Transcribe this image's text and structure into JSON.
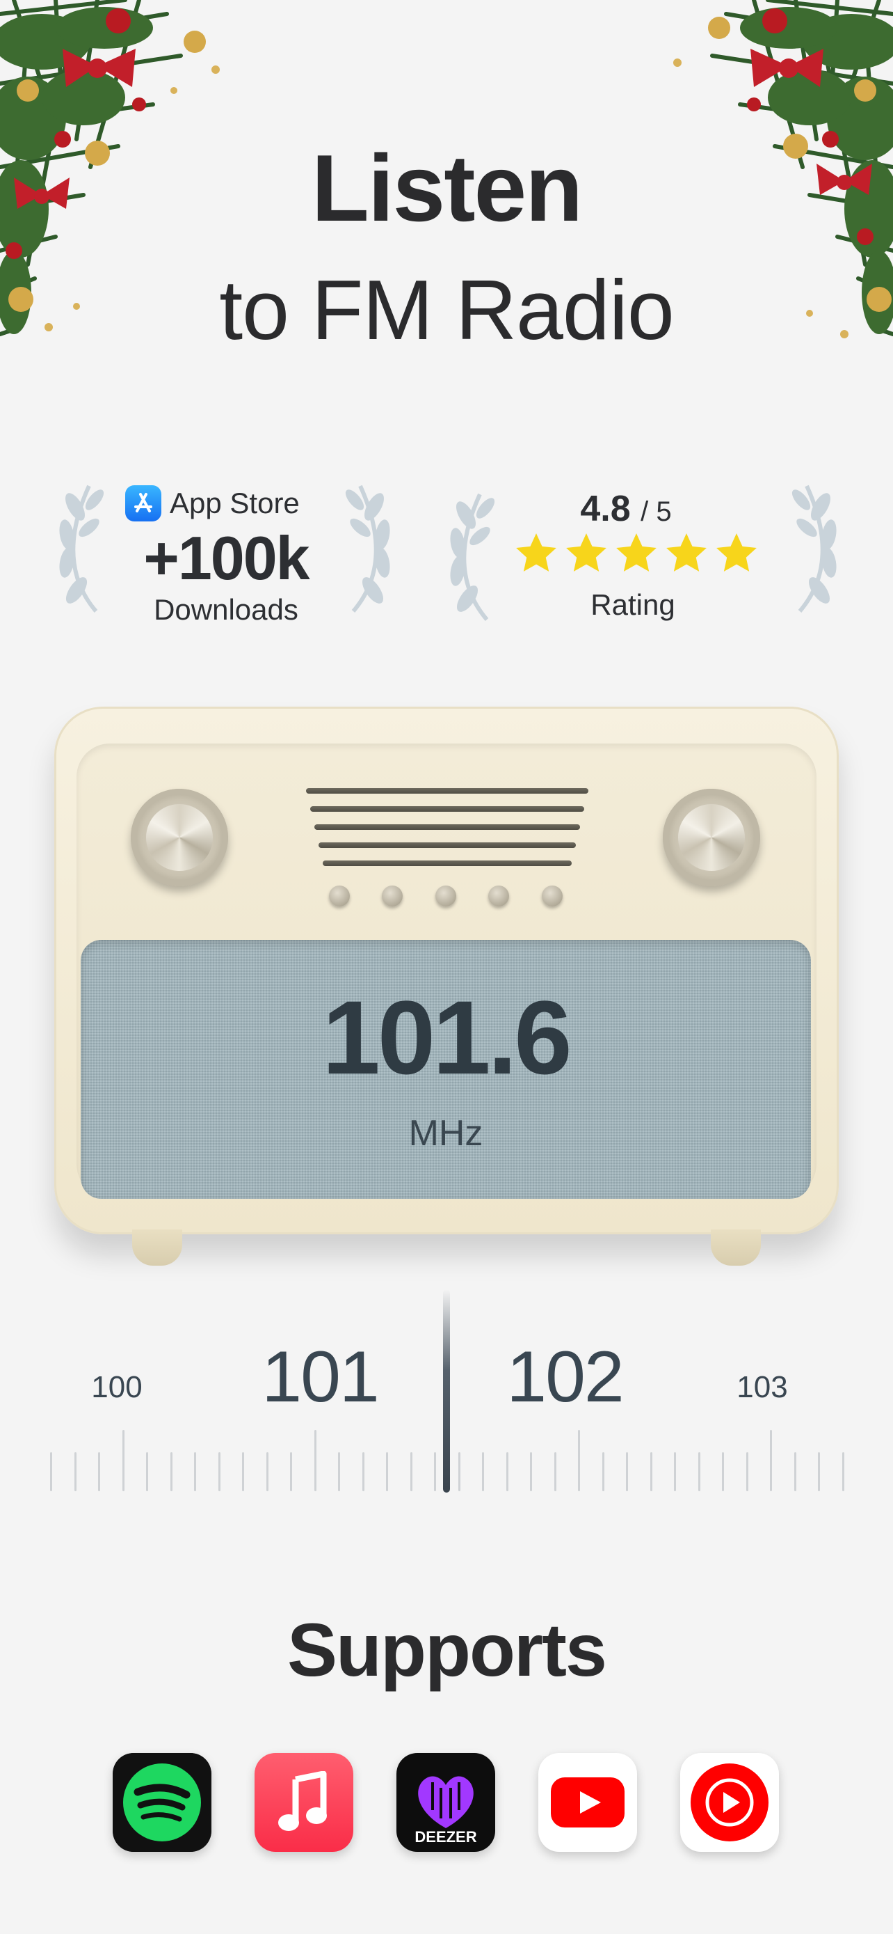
{
  "hero": {
    "title_line1": "Listen",
    "title_line2": "to FM Radio"
  },
  "badges": {
    "downloads": {
      "store_label": "App Store",
      "store_icon": "app-store-icon",
      "count": "+100k",
      "label": "Downloads"
    },
    "rating": {
      "value": "4.8",
      "scale": "/ 5",
      "stars": 5,
      "label": "Rating",
      "star_color": "#f7d51b"
    }
  },
  "radio": {
    "frequency": "101.6",
    "unit": "MHz",
    "body_color": "#f3ecd8",
    "screen_color": "#9eb3ba"
  },
  "dial": {
    "labels": [
      "100",
      "101",
      "102",
      "103"
    ]
  },
  "supports": {
    "title": "Supports",
    "apps": [
      {
        "name": "spotify-icon",
        "color": "#1ed760"
      },
      {
        "name": "apple-music-icon",
        "color": "#fa2d48"
      },
      {
        "name": "deezer-icon",
        "label": "DEEZER",
        "color": "#a238ff"
      },
      {
        "name": "youtube-icon",
        "color": "#ff0000"
      },
      {
        "name": "youtube-music-icon",
        "color": "#ff0000"
      }
    ]
  }
}
